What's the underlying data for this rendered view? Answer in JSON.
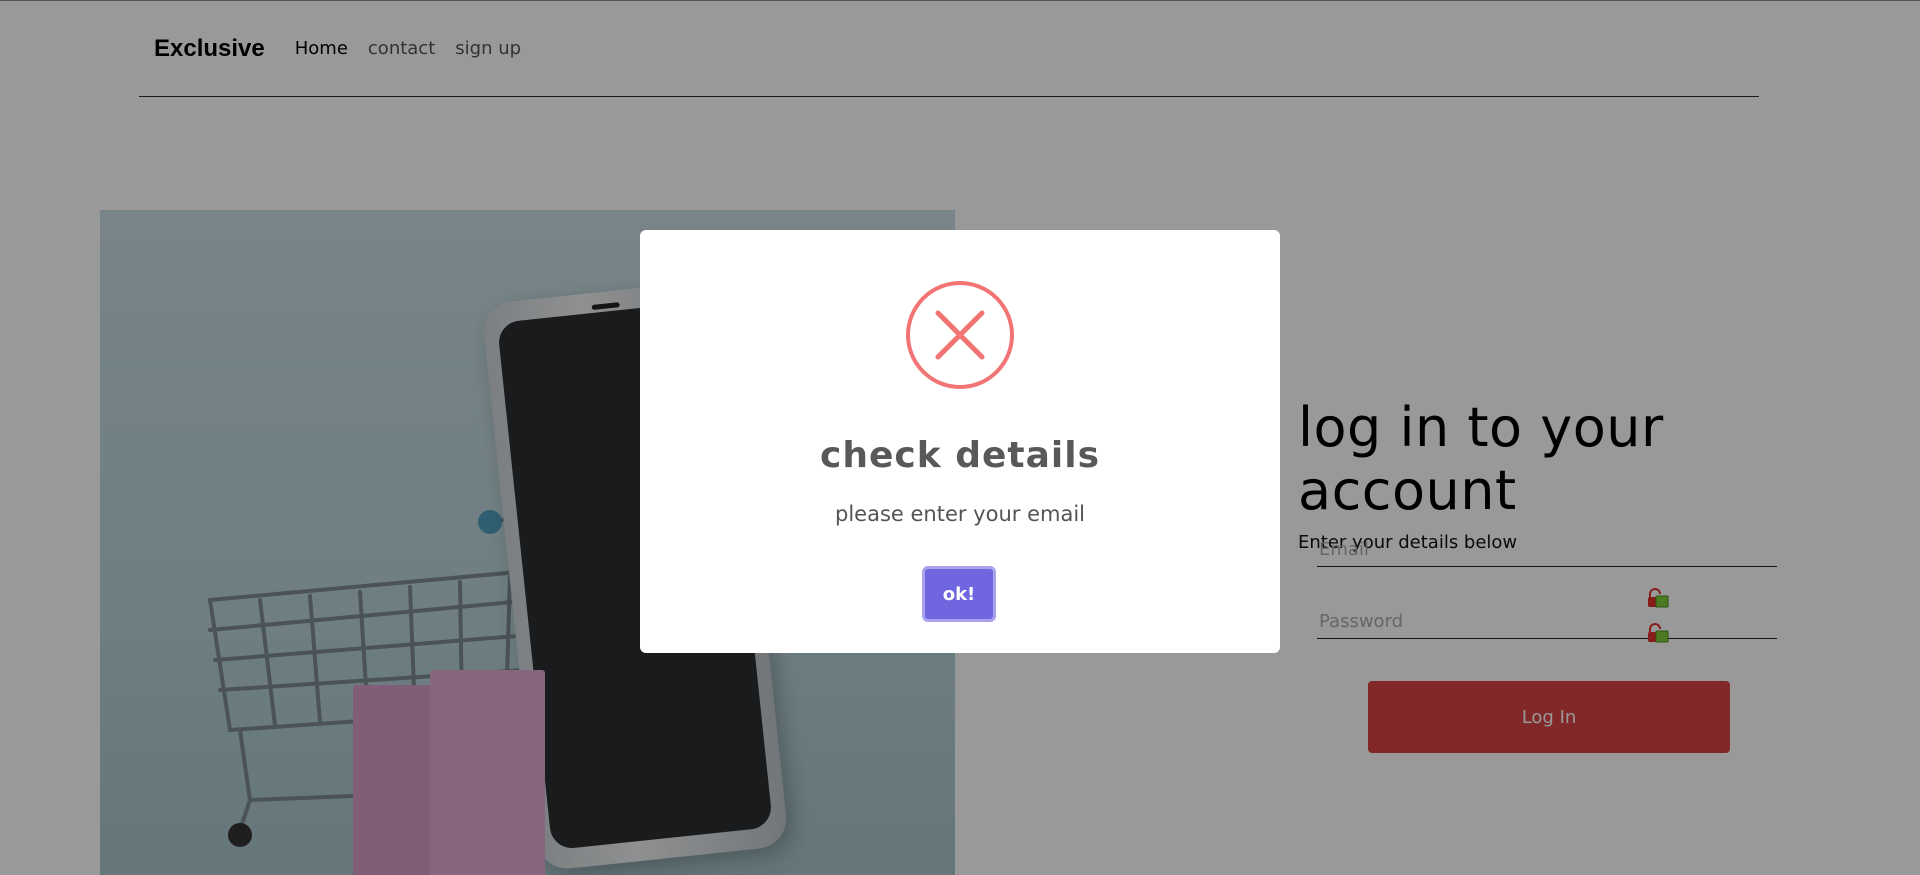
{
  "nav": {
    "brand": "Exclusive",
    "links": [
      {
        "label": "Home"
      },
      {
        "label": "contact"
      },
      {
        "label": "sign up"
      }
    ]
  },
  "hero": {
    "icon": "shopping-cart-phone-image"
  },
  "login": {
    "title": "log in to your account",
    "subtitle": "Enter your details below",
    "email_placeholder": "Email",
    "email_value": "",
    "password_placeholder": "Password",
    "password_value": "",
    "button_label": "Log In",
    "accent_color": "#db4444"
  },
  "modal": {
    "icon": "error-x-icon",
    "title": "check details",
    "message": "please enter your email",
    "ok_label": "ok!",
    "icon_color": "#f27474",
    "button_color": "#7066e0"
  }
}
